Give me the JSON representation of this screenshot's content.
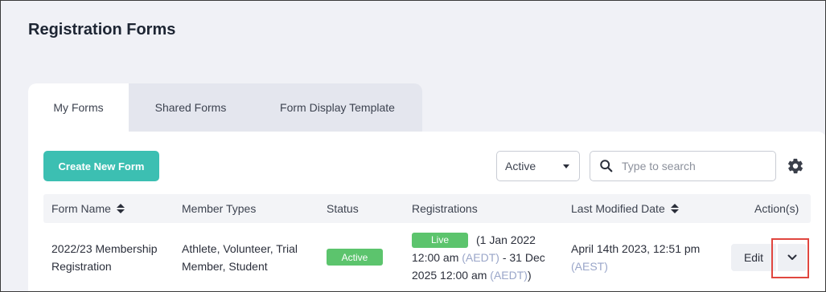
{
  "page": {
    "title": "Registration Forms"
  },
  "tabs": [
    {
      "label": "My Forms",
      "active": true
    },
    {
      "label": "Shared Forms",
      "active": false
    },
    {
      "label": "Form Display Template",
      "active": false
    }
  ],
  "toolbar": {
    "create_label": "Create New Form",
    "status_filter": {
      "selected": "Active"
    },
    "search": {
      "placeholder": "Type to search",
      "value": ""
    },
    "settings_icon": "gear-icon"
  },
  "table": {
    "columns": [
      {
        "label": "Form Name",
        "sortable": true
      },
      {
        "label": "Member Types",
        "sortable": false
      },
      {
        "label": "Status",
        "sortable": false
      },
      {
        "label": "Registrations",
        "sortable": false
      },
      {
        "label": "Last Modified Date",
        "sortable": true
      },
      {
        "label": "Action(s)",
        "sortable": false
      }
    ],
    "rows": [
      {
        "form_name_line1": "2022/23 Membership",
        "form_name_line2": "Registration",
        "member_types_line1": "Athlete, Volunteer, Trial",
        "member_types_line2": "Member, Student",
        "status": "Active",
        "registrations": {
          "badge": "Live",
          "line1": "(1 Jan 2022",
          "line2_a": "12:00 am",
          "line2_tz": "(AEDT)",
          "line2_b": "- 31 Dec",
          "line3_a": "2025 12:00 am",
          "line3_tz": "(AEDT)",
          "line3_b": ")"
        },
        "last_modified_line1": "April 14th 2023, 12:51 pm",
        "last_modified_tz": "(AEST)",
        "edit_label": "Edit"
      }
    ]
  },
  "colors": {
    "accent": "#3cbfb2",
    "status_green": "#5cc46d",
    "timezone_muted": "#9aa6c9",
    "highlight_red": "#e0463f"
  }
}
